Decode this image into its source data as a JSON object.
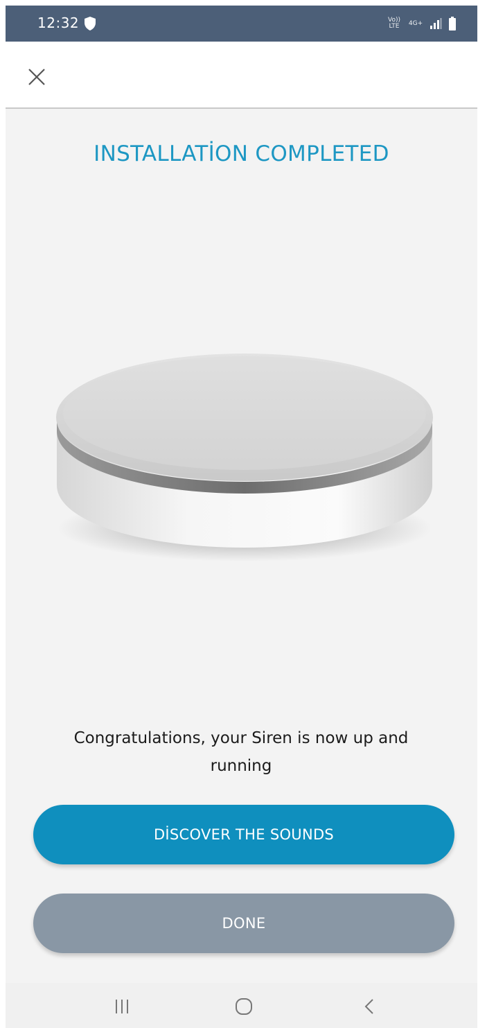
{
  "status_bar": {
    "time": "12:32",
    "network_top": "Vo)) LTE",
    "network_4g": "4G+",
    "icons": [
      "shield-icon",
      "signal-icon",
      "battery-icon"
    ]
  },
  "top_bar": {
    "close_icon": "close-icon"
  },
  "title": "INSTALLATİON COMPLETED",
  "device_image": "siren-device",
  "message": "Congratulations, your Siren is now up and running",
  "buttons": {
    "discover": "DİSCOVER THE SOUNDS",
    "done": "DONE"
  },
  "nav_bar": {
    "icons": [
      "recent-apps-icon",
      "home-icon",
      "back-icon"
    ]
  },
  "colors": {
    "status_bar": "#4c5f78",
    "title": "#1d97c3",
    "primary_button": "#0f8fbe",
    "secondary_button": "#8997a5",
    "background": "#f3f3f3"
  }
}
